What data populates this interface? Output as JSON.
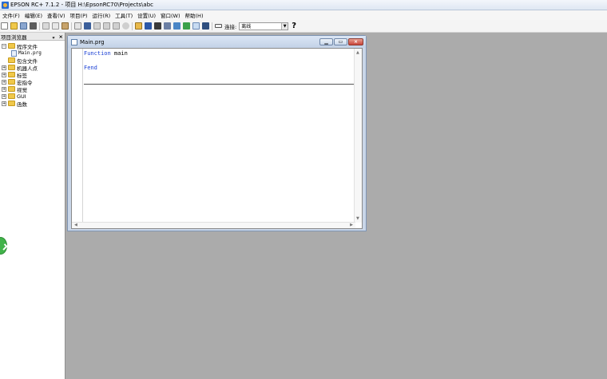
{
  "window": {
    "title": "EPSON RC+ 7.1.2 - 项目 H:\\EpsonRC70\\Projects\\abc"
  },
  "menu": {
    "items": [
      "文件(F)",
      "编辑(E)",
      "查看(V)",
      "项目(P)",
      "运行(R)",
      "工具(T)",
      "设置(U)",
      "窗口(W)",
      "帮助(H)"
    ]
  },
  "toolbar": {
    "connection_label": "连接:",
    "connection_value": "离线",
    "help_label": "?"
  },
  "project_panel": {
    "title": "项目浏览器",
    "pin_label": "ᵩ",
    "close_label": "×",
    "tree": [
      {
        "label": "程序文件",
        "expander": "−",
        "indent": 0
      },
      {
        "label": "Main.prg",
        "expander": "",
        "indent": 1
      },
      {
        "label": "包含文件",
        "expander": "",
        "indent": 0
      },
      {
        "label": "机器人点",
        "expander": "+",
        "indent": 0
      },
      {
        "label": "标签",
        "expander": "+",
        "indent": 0
      },
      {
        "label": "宏指令",
        "expander": "+",
        "indent": 0
      },
      {
        "label": "视觉",
        "expander": "+",
        "indent": 0
      },
      {
        "label": "GUI",
        "expander": "+",
        "indent": 0
      },
      {
        "label": "函数",
        "expander": "+",
        "indent": 0
      }
    ]
  },
  "editor_window": {
    "title": "Main.prg",
    "code": {
      "line1_keyword": "Function",
      "line1_name": " main",
      "line3_keyword": "Fend"
    }
  },
  "colors": {
    "workspace": "#ababab",
    "keyword": "#1a3fd4",
    "close_button": "#c9453a"
  }
}
